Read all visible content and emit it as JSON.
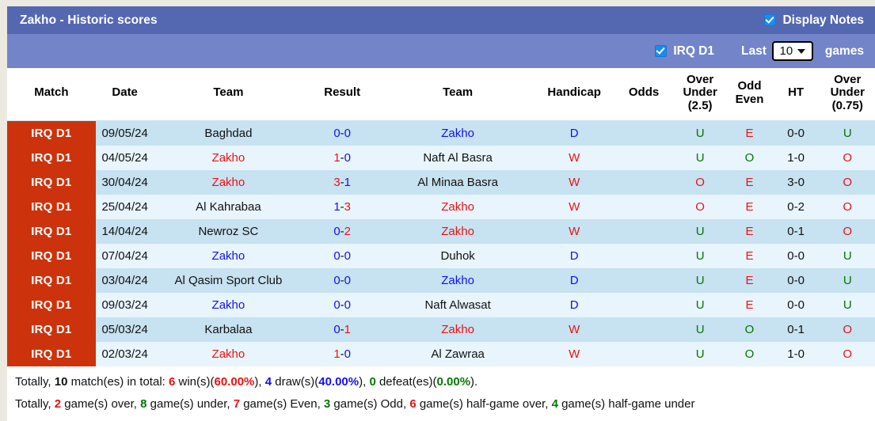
{
  "header": {
    "title": "Zakho - Historic scores",
    "display_notes_label": "Display Notes",
    "league_label": "IRQ D1",
    "last_label": "Last",
    "games_label": "games",
    "games_count": "10",
    "display_notes_checked": true,
    "league_checked": true
  },
  "colors": {
    "header_bar": "#5468b2",
    "header_subbar": "#7385c8",
    "league_badge": "#cc330c",
    "row_odd": "#c7e2f1",
    "row_even": "#e8f5fc",
    "red": "#ee1111",
    "blue": "#1111ee",
    "green": "#007700",
    "page_bg": "#ece9e0"
  },
  "columns": [
    "Match",
    "Date",
    "Team",
    "Result",
    "Team",
    "Handicap",
    "Odds",
    "Over Under (2.5)",
    "Odd Even",
    "HT",
    "Over Under (0.75)"
  ],
  "columns_multiline": {
    "ou25": [
      "Over",
      "Under",
      "(2.5)"
    ],
    "oddeven": [
      "Odd",
      "Even"
    ],
    "ht": [
      "HT"
    ],
    "ou075": [
      "Over",
      "Under",
      "(0.75)"
    ]
  },
  "rows": [
    {
      "league": "IRQ D1",
      "date": "09/05/24",
      "home": "Baghdad",
      "home_color": "black",
      "score_home": "0",
      "score_home_color": "blue",
      "score_sep": "-",
      "score_away": "0",
      "score_away_color": "blue",
      "away": "Zakho",
      "away_color": "blue",
      "handicap": "D",
      "handicap_color": "blue",
      "odds": "",
      "ou25": "U",
      "ou25_color": "green",
      "oddeven": "E",
      "oddeven_color": "red",
      "ht": "0-0",
      "ou075": "U",
      "ou075_color": "green"
    },
    {
      "league": "IRQ D1",
      "date": "04/05/24",
      "home": "Zakho",
      "home_color": "red",
      "score_home": "1",
      "score_home_color": "red",
      "score_sep": "-",
      "score_away": "0",
      "score_away_color": "blue",
      "away": "Naft Al Basra",
      "away_color": "black",
      "handicap": "W",
      "handicap_color": "red",
      "odds": "",
      "ou25": "U",
      "ou25_color": "green",
      "oddeven": "O",
      "oddeven_color": "green",
      "ht": "1-0",
      "ou075": "O",
      "ou075_color": "red"
    },
    {
      "league": "IRQ D1",
      "date": "30/04/24",
      "home": "Zakho",
      "home_color": "red",
      "score_home": "3",
      "score_home_color": "red",
      "score_sep": "-",
      "score_away": "1",
      "score_away_color": "blue",
      "away": "Al Minaa Basra",
      "away_color": "black",
      "handicap": "W",
      "handicap_color": "red",
      "odds": "",
      "ou25": "O",
      "ou25_color": "red",
      "oddeven": "E",
      "oddeven_color": "red",
      "ht": "3-0",
      "ou075": "O",
      "ou075_color": "red"
    },
    {
      "league": "IRQ D1",
      "date": "25/04/24",
      "home": "Al Kahrabaa",
      "home_color": "black",
      "score_home": "1",
      "score_home_color": "blue",
      "score_sep": "-",
      "score_away": "3",
      "score_away_color": "red",
      "away": "Zakho",
      "away_color": "red",
      "handicap": "W",
      "handicap_color": "red",
      "odds": "",
      "ou25": "O",
      "ou25_color": "red",
      "oddeven": "E",
      "oddeven_color": "red",
      "ht": "0-2",
      "ou075": "O",
      "ou075_color": "red"
    },
    {
      "league": "IRQ D1",
      "date": "14/04/24",
      "home": "Newroz SC",
      "home_color": "black",
      "score_home": "0",
      "score_home_color": "blue",
      "score_sep": "-",
      "score_away": "2",
      "score_away_color": "red",
      "away": "Zakho",
      "away_color": "red",
      "handicap": "W",
      "handicap_color": "red",
      "odds": "",
      "ou25": "U",
      "ou25_color": "green",
      "oddeven": "E",
      "oddeven_color": "red",
      "ht": "0-1",
      "ou075": "O",
      "ou075_color": "red"
    },
    {
      "league": "IRQ D1",
      "date": "07/04/24",
      "home": "Zakho",
      "home_color": "blue",
      "score_home": "0",
      "score_home_color": "blue",
      "score_sep": "-",
      "score_away": "0",
      "score_away_color": "blue",
      "away": "Duhok",
      "away_color": "black",
      "handicap": "D",
      "handicap_color": "blue",
      "odds": "",
      "ou25": "U",
      "ou25_color": "green",
      "oddeven": "E",
      "oddeven_color": "red",
      "ht": "0-0",
      "ou075": "U",
      "ou075_color": "green"
    },
    {
      "league": "IRQ D1",
      "date": "03/04/24",
      "home": "Al Qasim Sport Club",
      "home_color": "black",
      "score_home": "0",
      "score_home_color": "blue",
      "score_sep": "-",
      "score_away": "0",
      "score_away_color": "blue",
      "away": "Zakho",
      "away_color": "blue",
      "handicap": "D",
      "handicap_color": "blue",
      "odds": "",
      "ou25": "U",
      "ou25_color": "green",
      "oddeven": "E",
      "oddeven_color": "red",
      "ht": "0-0",
      "ou075": "U",
      "ou075_color": "green"
    },
    {
      "league": "IRQ D1",
      "date": "09/03/24",
      "home": "Zakho",
      "home_color": "blue",
      "score_home": "0",
      "score_home_color": "blue",
      "score_sep": "-",
      "score_away": "0",
      "score_away_color": "blue",
      "away": "Naft Alwasat",
      "away_color": "black",
      "handicap": "D",
      "handicap_color": "blue",
      "odds": "",
      "ou25": "U",
      "ou25_color": "green",
      "oddeven": "E",
      "oddeven_color": "red",
      "ht": "0-0",
      "ou075": "U",
      "ou075_color": "green"
    },
    {
      "league": "IRQ D1",
      "date": "05/03/24",
      "home": "Karbalaa",
      "home_color": "black",
      "score_home": "0",
      "score_home_color": "blue",
      "score_sep": "-",
      "score_away": "1",
      "score_away_color": "red",
      "away": "Zakho",
      "away_color": "red",
      "handicap": "W",
      "handicap_color": "red",
      "odds": "",
      "ou25": "U",
      "ou25_color": "green",
      "oddeven": "O",
      "oddeven_color": "green",
      "ht": "0-1",
      "ou075": "O",
      "ou075_color": "red"
    },
    {
      "league": "IRQ D1",
      "date": "02/03/24",
      "home": "Zakho",
      "home_color": "red",
      "score_home": "1",
      "score_home_color": "red",
      "score_sep": "-",
      "score_away": "0",
      "score_away_color": "blue",
      "away": "Al Zawraa",
      "away_color": "black",
      "handicap": "W",
      "handicap_color": "red",
      "odds": "",
      "ou25": "U",
      "ou25_color": "green",
      "oddeven": "O",
      "oddeven_color": "green",
      "ht": "1-0",
      "ou075": "O",
      "ou075_color": "red"
    }
  ],
  "summary": {
    "line1": {
      "p1": "Totally, ",
      "total": "10",
      "p2": " match(es) in total: ",
      "wins": "6",
      "p3": " win(s)(",
      "win_pct": "60.00%",
      "p4": "), ",
      "draws": "4",
      "p5": " draw(s)(",
      "draw_pct": "40.00%",
      "p6": "), ",
      "defeats": "0",
      "p7": " defeat(es)(",
      "defeat_pct": "0.00%",
      "p8": ")."
    },
    "line2": {
      "p1": "Totally, ",
      "over": "2",
      "p2": " game(s) over, ",
      "under": "8",
      "p3": " game(s) under, ",
      "even": "7",
      "p4": " game(s) Even, ",
      "odd": "3",
      "p5": " game(s) Odd, ",
      "half_over": "6",
      "p6": " game(s) half-game over, ",
      "half_under": "4",
      "p7": " game(s) half-game under"
    }
  }
}
